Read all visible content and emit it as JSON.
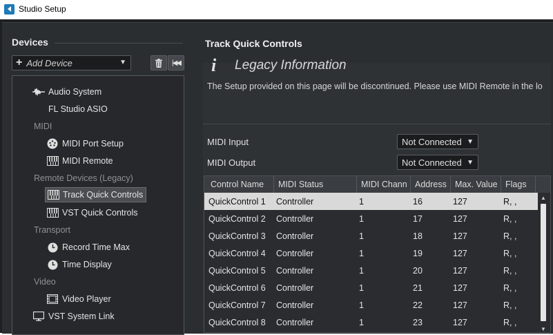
{
  "window": {
    "title": "Studio Setup"
  },
  "devices": {
    "title": "Devices",
    "add_device": "Add Device",
    "tree": {
      "audio_system": "Audio System",
      "asio_driver": "FL Studio ASIO",
      "cat_midi": "MIDI",
      "midi_port_setup": "MIDI Port Setup",
      "midi_remote": "MIDI Remote",
      "cat_remote": "Remote Devices (Legacy)",
      "track_quick_controls": "Track Quick Controls",
      "vst_quick_controls": "VST Quick Controls",
      "cat_transport": "Transport",
      "record_time_max": "Record Time Max",
      "time_display": "Time Display",
      "cat_video": "Video",
      "video_player": "Video Player",
      "vst_system_link": "VST System Link"
    }
  },
  "panel": {
    "title": "Track Quick Controls",
    "info_icon": "i",
    "legacy_title": "Legacy Information",
    "legacy_text": "The Setup provided on this page will be discontinued. Please use MIDI Remote in the lo",
    "midi_input_label": "MIDI Input",
    "midi_input_value": "Not Connected",
    "midi_output_label": "MIDI Output",
    "midi_output_value": "Not Connected"
  },
  "table": {
    "headers": [
      "Control Name",
      "MIDI Status",
      "MIDI Chann",
      "Address",
      "Max. Value",
      "Flags"
    ],
    "rows": [
      [
        "QuickControl 1",
        "Controller",
        "1",
        "16",
        "127",
        "R, ,"
      ],
      [
        "QuickControl 2",
        "Controller",
        "1",
        "17",
        "127",
        "R, ,"
      ],
      [
        "QuickControl 3",
        "Controller",
        "1",
        "18",
        "127",
        "R, ,"
      ],
      [
        "QuickControl 4",
        "Controller",
        "1",
        "19",
        "127",
        "R, ,"
      ],
      [
        "QuickControl 5",
        "Controller",
        "1",
        "20",
        "127",
        "R, ,"
      ],
      [
        "QuickControl 6",
        "Controller",
        "1",
        "21",
        "127",
        "R, ,"
      ],
      [
        "QuickControl 7",
        "Controller",
        "1",
        "22",
        "127",
        "R, ,"
      ],
      [
        "QuickControl 8",
        "Controller",
        "1",
        "23",
        "127",
        "R, ,"
      ]
    ]
  }
}
